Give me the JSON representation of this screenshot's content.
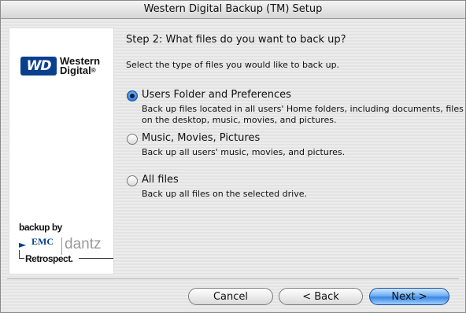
{
  "window": {
    "title": "Western Digital Backup (TM) Setup"
  },
  "sidebar": {
    "wd_logo": {
      "badge": "WD",
      "line1": "Western",
      "line2": "Digital",
      "mark": "®",
      "brand_color": "#0b3f8e"
    },
    "retrospect_logo": {
      "backup_by": "backup by",
      "emc": "EMC",
      "dantz": "dantz",
      "retrospect": "Retrospect."
    }
  },
  "main": {
    "step_title": "Step 2: What files do you want to back up?",
    "instruction": "Select the type of files you would like to back up.",
    "options": [
      {
        "label": "Users Folder and Preferences",
        "description": "Back up files located in all users' Home folders, including documents, files on the desktop, music, movies, and pictures.",
        "selected": true
      },
      {
        "label": "Music, Movies, Pictures",
        "description": "Back up all users' music, movies, and pictures.",
        "selected": false
      },
      {
        "label": "All files",
        "description": "Back up all files on the selected drive.",
        "selected": false
      }
    ]
  },
  "buttons": {
    "cancel": "Cancel",
    "back": "< Back",
    "next": "Next >",
    "accent_color": "#3b86e3"
  }
}
